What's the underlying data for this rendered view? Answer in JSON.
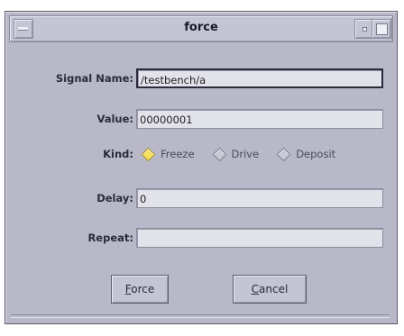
{
  "window": {
    "title": "force"
  },
  "form": {
    "signal_name": {
      "label": "Signal Name:",
      "value": "/testbench/a"
    },
    "value": {
      "label": "Value:",
      "value": "00000001"
    },
    "kind": {
      "label": "Kind:",
      "options": [
        "Freeze",
        "Drive",
        "Deposit"
      ],
      "selected": "Freeze"
    },
    "delay": {
      "label": "Delay:",
      "value": "0"
    },
    "repeat": {
      "label": "Repeat:",
      "value": ""
    }
  },
  "buttons": {
    "force": {
      "mnemonic": "F",
      "rest": "orce"
    },
    "cancel": {
      "mnemonic": "C",
      "rest": "ancel"
    }
  },
  "colors": {
    "window_bg": "#b8b8c8",
    "field_bg": "#e2e2ea",
    "radio_selected": "#f6e060"
  },
  "icons": [
    "window-menu-icon",
    "minimize-icon",
    "maximize-icon",
    "radio-diamond-icon"
  ]
}
